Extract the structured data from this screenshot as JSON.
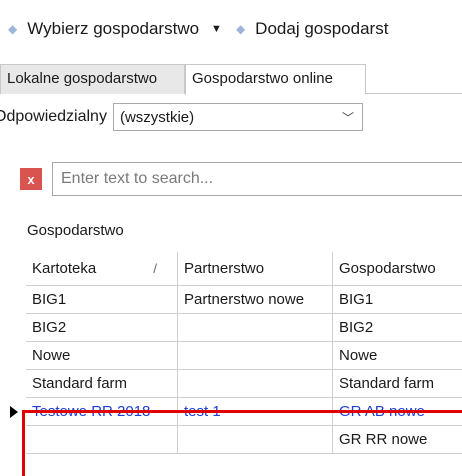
{
  "toolbar": {
    "select_farm": "Wybierz gospodarstwo",
    "add_farm": "Dodaj gospodarst"
  },
  "tabs": {
    "local": "Lokalne gospodarstwo",
    "online": "Gospodarstwo online"
  },
  "filter": {
    "label": "Odpowiedzialny",
    "value": "(wszystkie)"
  },
  "search": {
    "clear": "x",
    "placeholder": "Enter text to search..."
  },
  "grid": {
    "group_header": "Gospodarstwo",
    "columns": [
      "Kartoteka",
      "Partnerstwo",
      "Gospodarstwo"
    ],
    "sort_marker": "/",
    "rows": [
      [
        "BIG1",
        "Partnerstwo nowe",
        "BIG1"
      ],
      [
        "BIG2",
        "",
        "BIG2"
      ],
      [
        "Nowe",
        "",
        "Nowe"
      ],
      [
        "Standard farm",
        "",
        "Standard farm"
      ],
      [
        "Testowe RR 2018",
        "test 1",
        "GR AB nowe"
      ],
      [
        "",
        "",
        "GR RR nowe"
      ]
    ],
    "selected_row": 4
  },
  "colors": {
    "highlight": "#e00000",
    "selected_text": "#1f3fd1",
    "clear_button": "#d9534f"
  }
}
